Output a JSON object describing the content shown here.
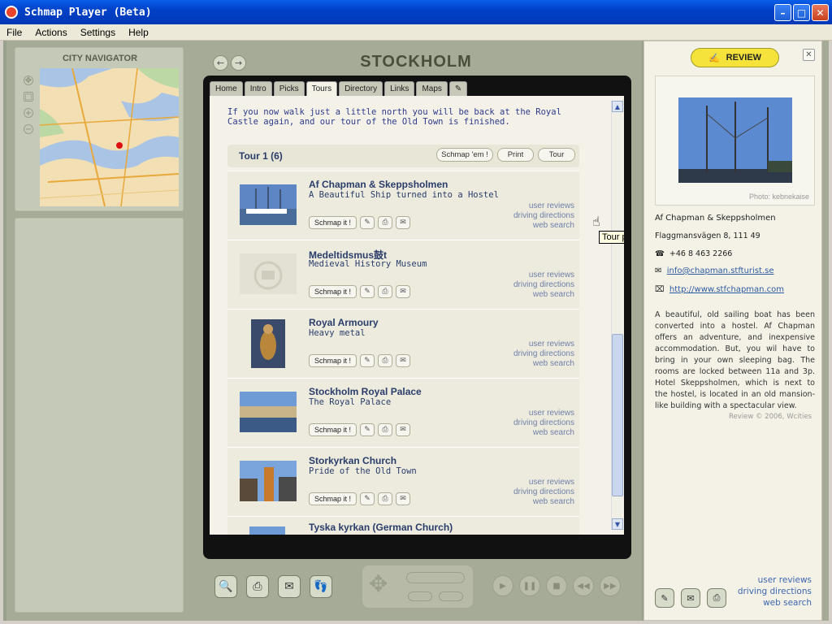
{
  "window": {
    "title": "Schmap Player (Beta)",
    "min": "–",
    "max": "□",
    "close": "✕"
  },
  "menu": [
    "File",
    "Actions",
    "Settings",
    "Help"
  ],
  "navigator": {
    "title": "CITY NAVIGATOR"
  },
  "city": {
    "name": "STOCKHOLM",
    "back": "←",
    "forward": "→"
  },
  "tabs": [
    "Home",
    "Intro",
    "Picks",
    "Tours",
    "Directory",
    "Links",
    "Maps",
    "✎"
  ],
  "active_tab": "Tours",
  "intro_text": "If you now walk just a little north you will be back at the Royal Castle again, and our tour of the Old Town is finished.",
  "tour": {
    "title": "Tour 1 (6)",
    "schmap_em": "Schmap 'em !",
    "print": "Print",
    "tour_btn": "Tour",
    "tooltip": "Tour places"
  },
  "item_btn": "Schmap it !",
  "item_links": [
    "user reviews",
    "driving directions",
    "web search"
  ],
  "items": [
    {
      "name": "Af Chapman & Skeppsholmen",
      "sub": "A Beautiful Ship turned into a Hostel"
    },
    {
      "name": "Medeltidsmus鼓t",
      "sub": "Medieval History Museum"
    },
    {
      "name": "Royal Armoury",
      "sub": "Heavy metal"
    },
    {
      "name": "Stockholm Royal Palace",
      "sub": "The Royal Palace"
    },
    {
      "name": "Storkyrkan Church",
      "sub": "Pride of the Old Town"
    },
    {
      "name": "Tyska kyrkan (German Church)",
      "sub": ""
    }
  ],
  "review": {
    "button": "REVIEW",
    "close": "✕",
    "photo_credit": "Photo: kebnekaise",
    "name": "Af Chapman & Skeppsholmen",
    "address": "Flaggmansvägen 8,  111 49",
    "phone": "+46 8 463 2266",
    "email": "info@chapman.stfturist.se",
    "url": "http://www.stfchapman.com",
    "description": "A beautiful, old sailing boat has been converted into a hostel. Af Chapman offers an adventure, and inexpensive accommodation. But, you wil have to bring in your own sleeping bag. The rooms are locked between 11a and 3p. Hotel Skeppsholmen, which is next to the hostel, is located in an old mansion-like building with a spectacular view.",
    "credit": "Review © 2006, Wcities",
    "links": [
      "user reviews",
      "driving directions",
      "web search"
    ]
  }
}
